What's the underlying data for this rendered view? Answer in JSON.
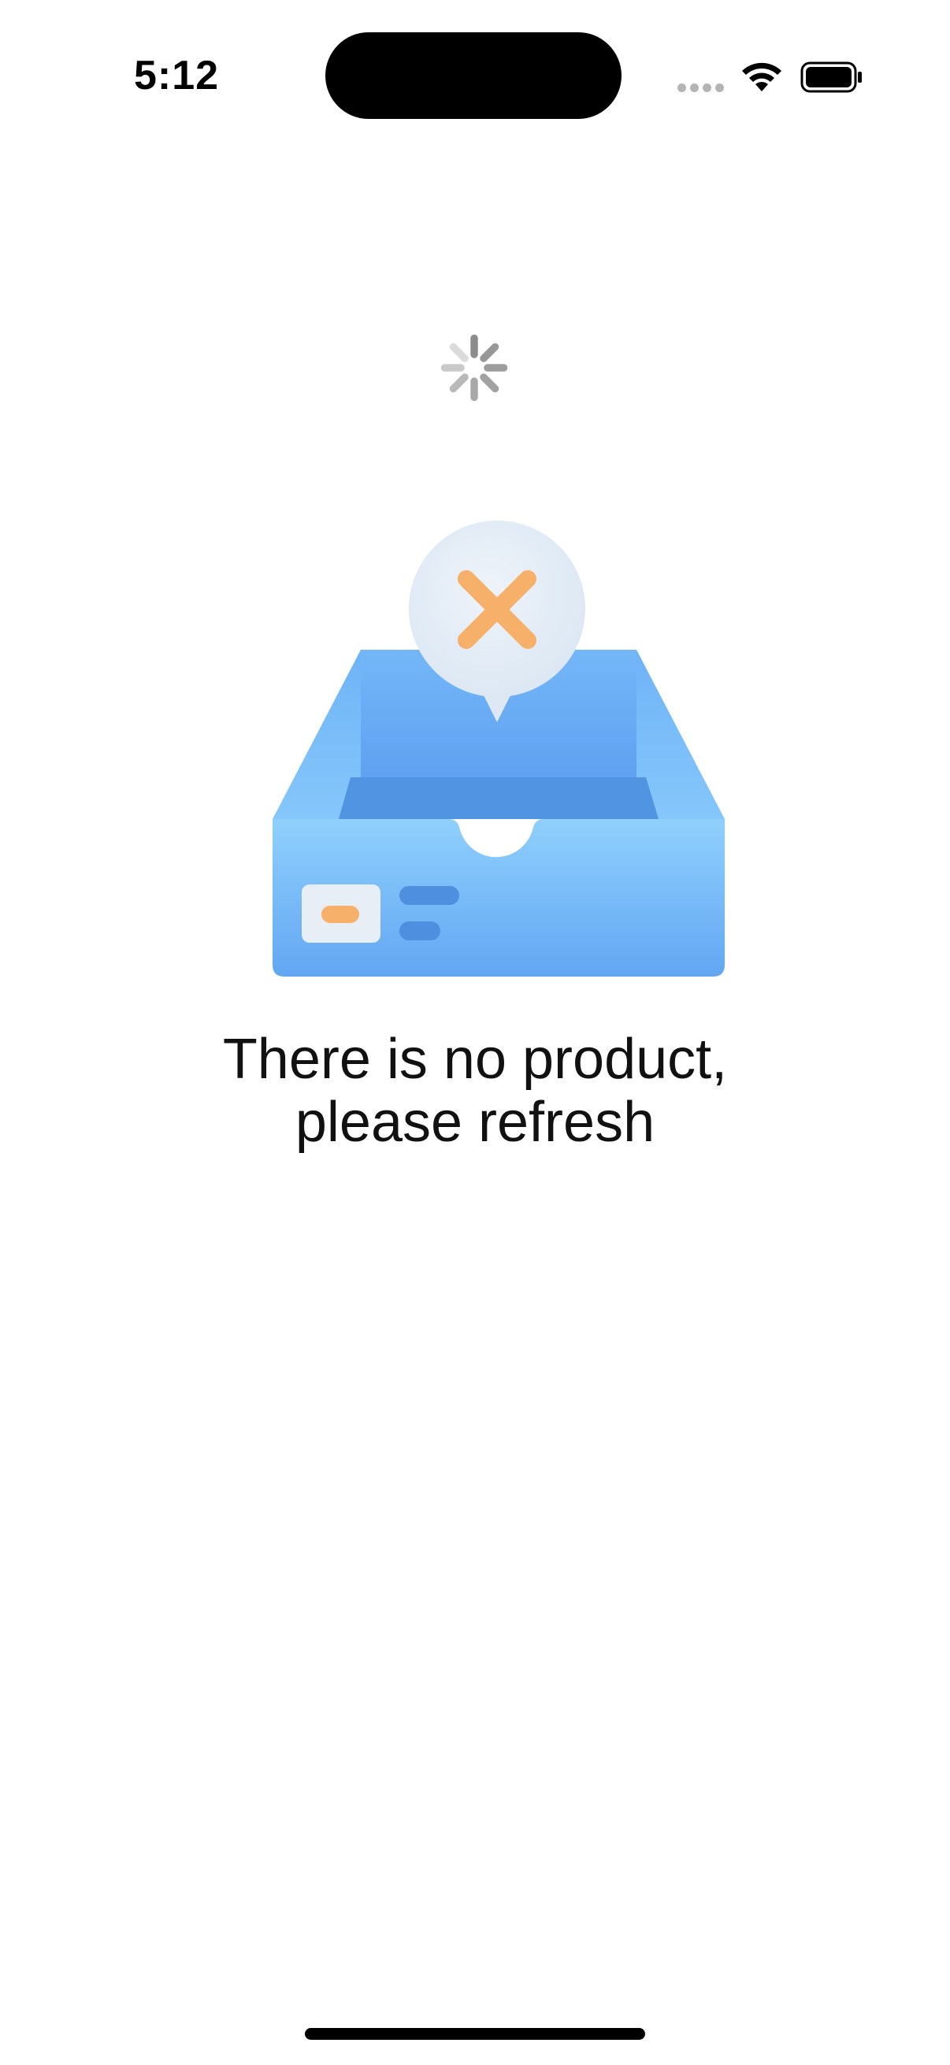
{
  "status_bar": {
    "time": "5:12",
    "icons": [
      "signal-dots-icon",
      "wifi-icon",
      "battery-icon"
    ]
  },
  "loading": {
    "icon": "loading-spinner-icon"
  },
  "empty_state": {
    "illustration": "empty-inbox-icon",
    "message_line_1": "There is no product,",
    "message_line_2": "please refresh"
  },
  "colors": {
    "background": "#ffffff",
    "tray_blue": "#64aaf5",
    "tray_light": "#8fd0fc",
    "accent_orange": "#f7b06a",
    "bubble": "#e3ecf6",
    "spinner_gray": "#8c8c8c"
  }
}
